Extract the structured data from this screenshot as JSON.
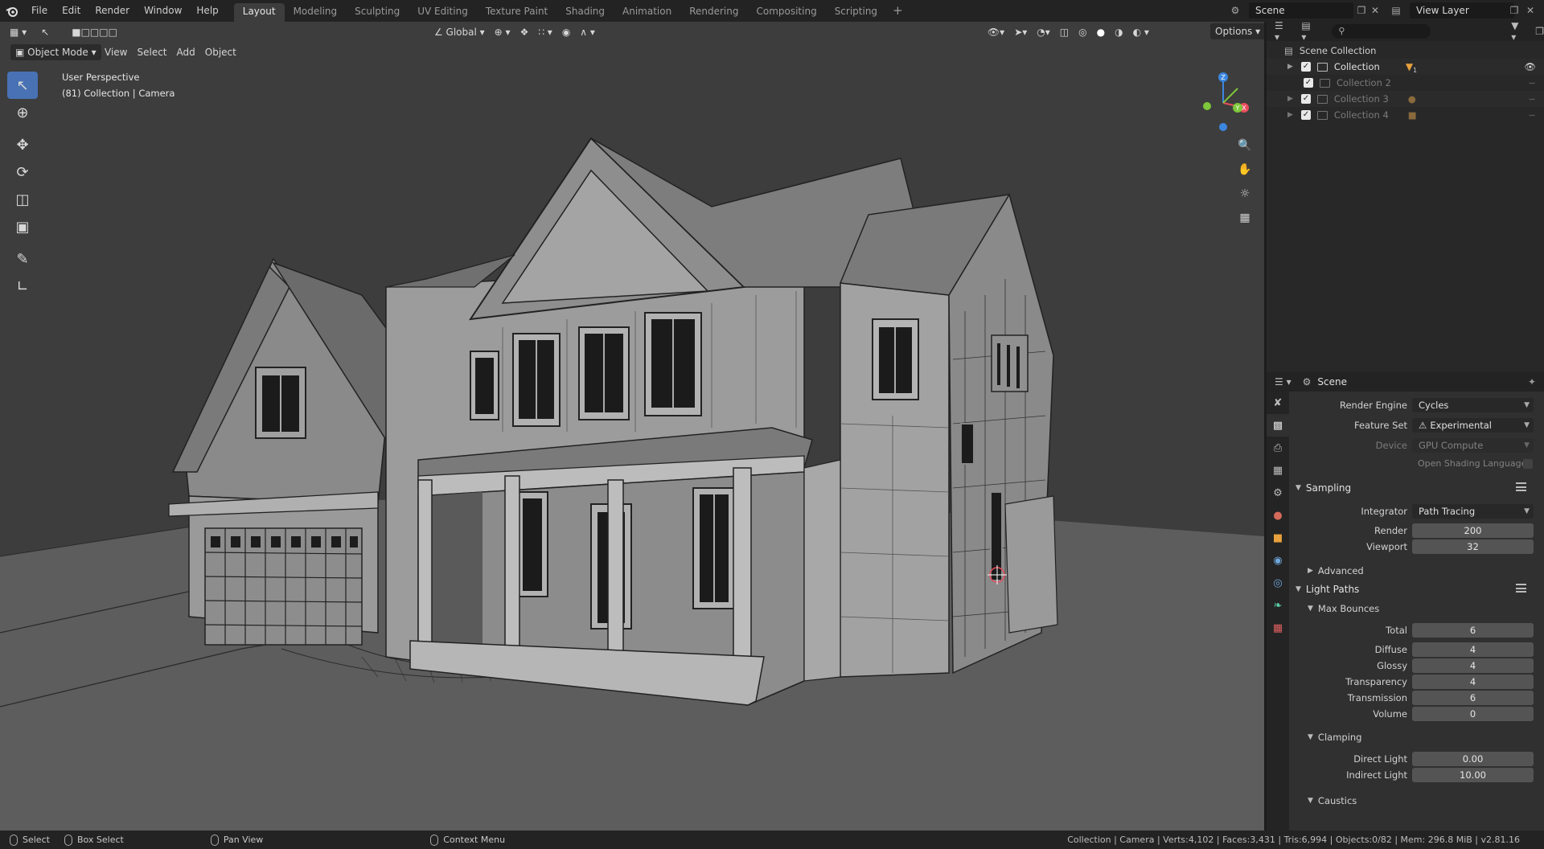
{
  "menu": [
    "File",
    "Edit",
    "Render",
    "Window",
    "Help"
  ],
  "workspaces": [
    "Layout",
    "Modeling",
    "Sculpting",
    "UV Editing",
    "Texture Paint",
    "Shading",
    "Animation",
    "Rendering",
    "Compositing",
    "Scripting"
  ],
  "active_workspace": "Layout",
  "scene_name": "Scene",
  "view_layer_name": "View Layer",
  "viewport": {
    "mode": "Object Mode",
    "menus": [
      "View",
      "Select",
      "Add",
      "Object"
    ],
    "transform_orientation": "Global",
    "options_label": "Options",
    "view_name": "User Perspective",
    "view_context": "(81) Collection | Camera",
    "gizmo_axes": [
      "X",
      "Y",
      "Z"
    ]
  },
  "outliner": {
    "root": "Scene Collection",
    "items": [
      {
        "label": "Collection"
      },
      {
        "label": "Collection 2"
      },
      {
        "label": "Collection 3"
      },
      {
        "label": "Collection 4"
      }
    ],
    "badge": "1"
  },
  "properties": {
    "context": "Scene",
    "render_engine_label": "Render Engine",
    "render_engine": "Cycles",
    "feature_set_label": "Feature Set",
    "feature_set": "Experimental",
    "device_label": "Device",
    "device": "GPU Compute",
    "osl_label": "Open Shading Language",
    "sampling": {
      "title": "Sampling",
      "integrator_label": "Integrator",
      "integrator": "Path Tracing",
      "render_label": "Render",
      "render": "200",
      "viewport_label": "Viewport",
      "viewport": "32",
      "advanced": "Advanced"
    },
    "light_paths": {
      "title": "Light Paths",
      "max_bounces": "Max Bounces",
      "rows": [
        {
          "label": "Total",
          "value": "6"
        },
        {
          "label": "Diffuse",
          "value": "4"
        },
        {
          "label": "Glossy",
          "value": "4"
        },
        {
          "label": "Transparency",
          "value": "4"
        },
        {
          "label": "Transmission",
          "value": "6"
        },
        {
          "label": "Volume",
          "value": "0"
        }
      ],
      "clamping": "Clamping",
      "direct_light_label": "Direct Light",
      "direct_light": "0.00",
      "indirect_light_label": "Indirect Light",
      "indirect_light": "10.00",
      "caustics": "Caustics"
    }
  },
  "statusbar": {
    "select": "Select",
    "box_select": "Box Select",
    "pan_view": "Pan View",
    "context_menu": "Context Menu",
    "stats": "Collection | Camera | Verts:4,102 | Faces:3,431 | Tris:6,994 | Objects:0/82 | Mem: 296.8 MiB | v2.81.16"
  },
  "colors": {
    "accent": "#4872b4",
    "x_axis": "#e84c5c",
    "y_axis": "#7ec63a",
    "z_axis": "#3c86e0"
  }
}
